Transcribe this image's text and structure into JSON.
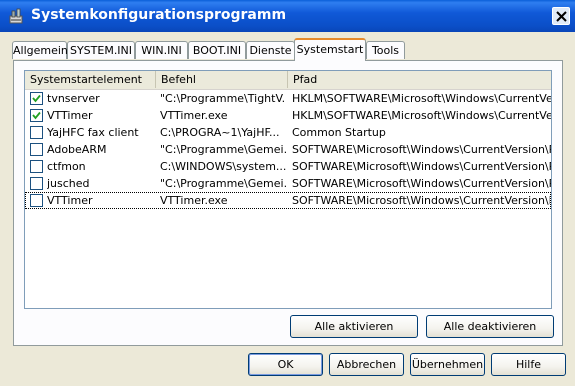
{
  "window": {
    "title": "Systemkonfigurationsprogramm"
  },
  "tabs": [
    {
      "label": "Allgemein"
    },
    {
      "label": "SYSTEM.INI"
    },
    {
      "label": "WIN.INI"
    },
    {
      "label": "BOOT.INI"
    },
    {
      "label": "Dienste"
    },
    {
      "label": "Systemstart",
      "active": true
    },
    {
      "label": "Tools"
    }
  ],
  "table": {
    "columns": [
      "Systemstartelement",
      "Befehl",
      "Pfad"
    ],
    "rows": [
      {
        "checked": true,
        "element": "tvnserver",
        "command": "\"C:\\Programme\\TightV...",
        "path": "HKLM\\SOFTWARE\\Microsoft\\Windows\\CurrentVer..."
      },
      {
        "checked": true,
        "element": "VTTimer",
        "command": "VTTimer.exe",
        "path": "HKLM\\SOFTWARE\\Microsoft\\Windows\\CurrentVer..."
      },
      {
        "checked": false,
        "element": "YajHFC fax client",
        "command": "C:\\PROGRA~1\\YajHF...",
        "path": "Common Startup"
      },
      {
        "checked": false,
        "element": "AdobeARM",
        "command": "\"C:\\Programme\\Gemei...",
        "path": "SOFTWARE\\Microsoft\\Windows\\CurrentVersion\\Run"
      },
      {
        "checked": false,
        "element": "ctfmon",
        "command": "C:\\WINDOWS\\system...",
        "path": "SOFTWARE\\Microsoft\\Windows\\CurrentVersion\\Run"
      },
      {
        "checked": false,
        "element": "jusched",
        "command": "\"C:\\Programme\\Gemei...",
        "path": "SOFTWARE\\Microsoft\\Windows\\CurrentVersion\\Run"
      },
      {
        "checked": false,
        "element": "VTTimer",
        "command": "VTTimer.exe",
        "path": "SOFTWARE\\Microsoft\\Windows\\CurrentVersion\\Run",
        "focused": true
      }
    ]
  },
  "buttons": {
    "enable_all": "Alle aktivieren",
    "disable_all": "Alle deaktivieren",
    "ok": "OK",
    "cancel": "Abbrechen",
    "apply": "Übernehmen",
    "help": "Hilfe"
  }
}
